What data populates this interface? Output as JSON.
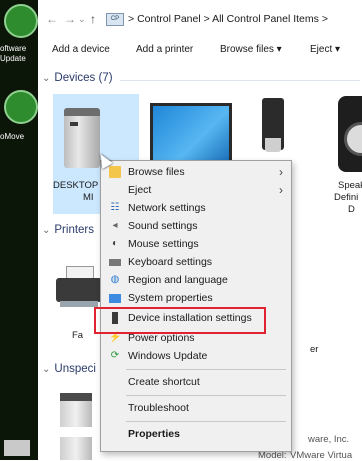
{
  "desktop": {
    "items": [
      {
        "label1": "oftware",
        "label2": "Update"
      },
      {
        "label1": "oMove",
        "label2": ""
      }
    ]
  },
  "address": {
    "crumbs": [
      "Control Panel",
      "All Control Panel Items"
    ],
    "separator": ">",
    "cp_icon_text": "CP"
  },
  "toolbar": {
    "add_device": "Add a device",
    "add_printer": "Add a printer",
    "browse_files": "Browse files ▾",
    "eject": "Eject ▾"
  },
  "groups": {
    "devices": "Devices (7)",
    "printers": "Printers",
    "unspecified": "Unspeci"
  },
  "tiles": {
    "pc_line1": "DESKTOP",
    "pc_line2": "MI",
    "usb_partial": "h",
    "speaker_line1": "Speak",
    "speaker_line2": "Defini",
    "speaker_line3": "D",
    "printer_partial": "Fa",
    "printer2_partial": "er"
  },
  "details": {
    "vendor": "ware, Inc.",
    "model_label": "Model:",
    "model_value": "VMware Virtua"
  },
  "context_menu": {
    "items": [
      {
        "label": "Browse files",
        "icon": "folder-icon",
        "submenu": true
      },
      {
        "label": "Eject",
        "icon": "blank",
        "submenu": true
      },
      {
        "label": "Network settings",
        "icon": "network-icon",
        "submenu": false
      },
      {
        "label": "Sound settings",
        "icon": "speaker-icon",
        "submenu": false
      },
      {
        "label": "Mouse settings",
        "icon": "mouse-icon",
        "submenu": false
      },
      {
        "label": "Keyboard settings",
        "icon": "keyboard-icon",
        "submenu": false
      },
      {
        "label": "Region and language",
        "icon": "globe-icon",
        "submenu": false
      },
      {
        "label": "System properties",
        "icon": "system-icon",
        "submenu": false
      },
      {
        "label": "Device installation settings",
        "icon": "device-install-icon",
        "submenu": false
      },
      {
        "label": "Power options",
        "icon": "power-icon",
        "submenu": false
      },
      {
        "label": "Windows Update",
        "icon": "update-icon",
        "submenu": false
      },
      {
        "label": "Create shortcut",
        "icon": "blank",
        "submenu": false
      },
      {
        "label": "Troubleshoot",
        "icon": "blank",
        "submenu": false
      },
      {
        "label": "Properties",
        "icon": "blank",
        "submenu": false
      }
    ],
    "highlighted_item": "Device installation settings"
  },
  "colors": {
    "highlight_border": "#e0242f",
    "selection": "#cce8ff",
    "menu_background": "#f0f0f0"
  }
}
